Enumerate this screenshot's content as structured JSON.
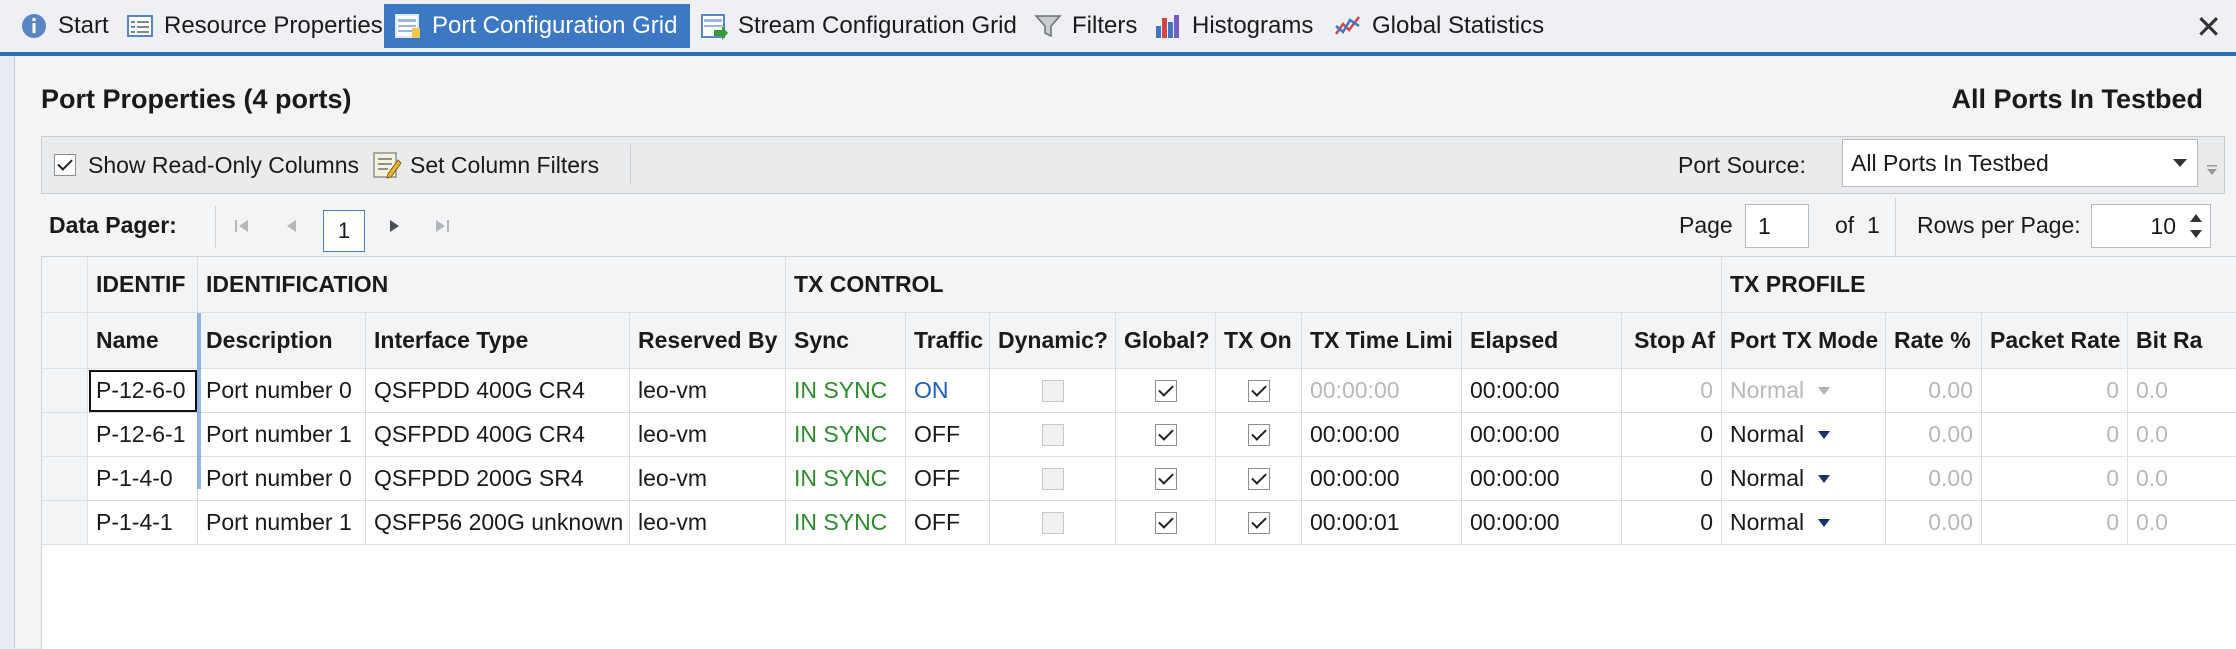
{
  "tabs": [
    {
      "label": "Start",
      "icon": "info-icon"
    },
    {
      "label": "Resource Properties",
      "icon": "properties-icon"
    },
    {
      "label": "Port Configuration Grid",
      "icon": "grid-icon",
      "active": true
    },
    {
      "label": "Stream Configuration Grid",
      "icon": "stream-grid-icon"
    },
    {
      "label": "Filters",
      "icon": "filter-icon"
    },
    {
      "label": "Histograms",
      "icon": "histogram-icon"
    },
    {
      "label": "Global Statistics",
      "icon": "statistics-icon"
    }
  ],
  "close_glyph": "✕",
  "panel": {
    "title": "Port Properties (4 ports)",
    "right_title": "All Ports In Testbed"
  },
  "toolbar": {
    "show_readonly_label": "Show Read-Only Columns",
    "show_readonly_checked": true,
    "set_filters_label": "Set Column Filters",
    "port_source_label": "Port Source:",
    "port_source_value": "All Ports In Testbed"
  },
  "pager": {
    "label": "Data Pager:",
    "current_page": "1",
    "page_label": "Page",
    "page_value": "1",
    "of_label": "of",
    "total_pages": "1",
    "rows_per_page_label": "Rows per Page:",
    "rows_per_page_value": "10"
  },
  "grid": {
    "groups": [
      "IDENTIF",
      "IDENTIFICATION",
      "TX CONTROL",
      "TX PROFILE"
    ],
    "columns": [
      "Name",
      "Description",
      "Interface Type",
      "Reserved By",
      "Sync",
      "Traffic",
      "Dynamic?",
      "Global?",
      "TX On",
      "TX Time Limi",
      "Elapsed",
      "Stop Af",
      "Port TX Mode",
      "Rate %",
      "Packet Rate",
      "Bit Ra"
    ],
    "rows": [
      {
        "name": "P-12-6-0",
        "description": "Port number 0",
        "interface": "QSFPDD 400G CR4",
        "reserved_by": "leo-vm",
        "sync": "IN SYNC",
        "traffic": "ON",
        "dynamic": false,
        "global": true,
        "tx_on": true,
        "tx_time_limit": "00:00:00",
        "elapsed": "00:00:00",
        "stop_after": "0",
        "port_tx_mode": "Normal",
        "rate_pct": "0.00",
        "packet_rate": "0",
        "bit_rate": "0.0"
      },
      {
        "name": "P-12-6-1",
        "description": "Port number 1",
        "interface": "QSFPDD 400G CR4",
        "reserved_by": "leo-vm",
        "sync": "IN SYNC",
        "traffic": "OFF",
        "dynamic": false,
        "global": true,
        "tx_on": true,
        "tx_time_limit": "00:00:00",
        "elapsed": "00:00:00",
        "stop_after": "0",
        "port_tx_mode": "Normal",
        "rate_pct": "0.00",
        "packet_rate": "0",
        "bit_rate": "0.0"
      },
      {
        "name": "P-1-4-0",
        "description": "Port number 0",
        "interface": "QSFPDD 200G SR4",
        "reserved_by": "leo-vm",
        "sync": "IN SYNC",
        "traffic": "OFF",
        "dynamic": false,
        "global": true,
        "tx_on": true,
        "tx_time_limit": "00:00:00",
        "elapsed": "00:00:00",
        "stop_after": "0",
        "port_tx_mode": "Normal",
        "rate_pct": "0.00",
        "packet_rate": "0",
        "bit_rate": "0.0"
      },
      {
        "name": "P-1-4-1",
        "description": "Port number 1",
        "interface": "QSFP56 200G unknown",
        "reserved_by": "leo-vm",
        "sync": "IN SYNC",
        "traffic": "OFF",
        "dynamic": false,
        "global": true,
        "tx_on": true,
        "tx_time_limit": "00:00:01",
        "elapsed": "00:00:00",
        "stop_after": "0",
        "port_tx_mode": "Normal",
        "rate_pct": "0.00",
        "packet_rate": "0",
        "bit_rate": "0.0"
      }
    ]
  },
  "colors": {
    "accent": "#3c78c4",
    "sync_green": "#2e8b2e",
    "traffic_on_blue": "#1f5fb7"
  }
}
